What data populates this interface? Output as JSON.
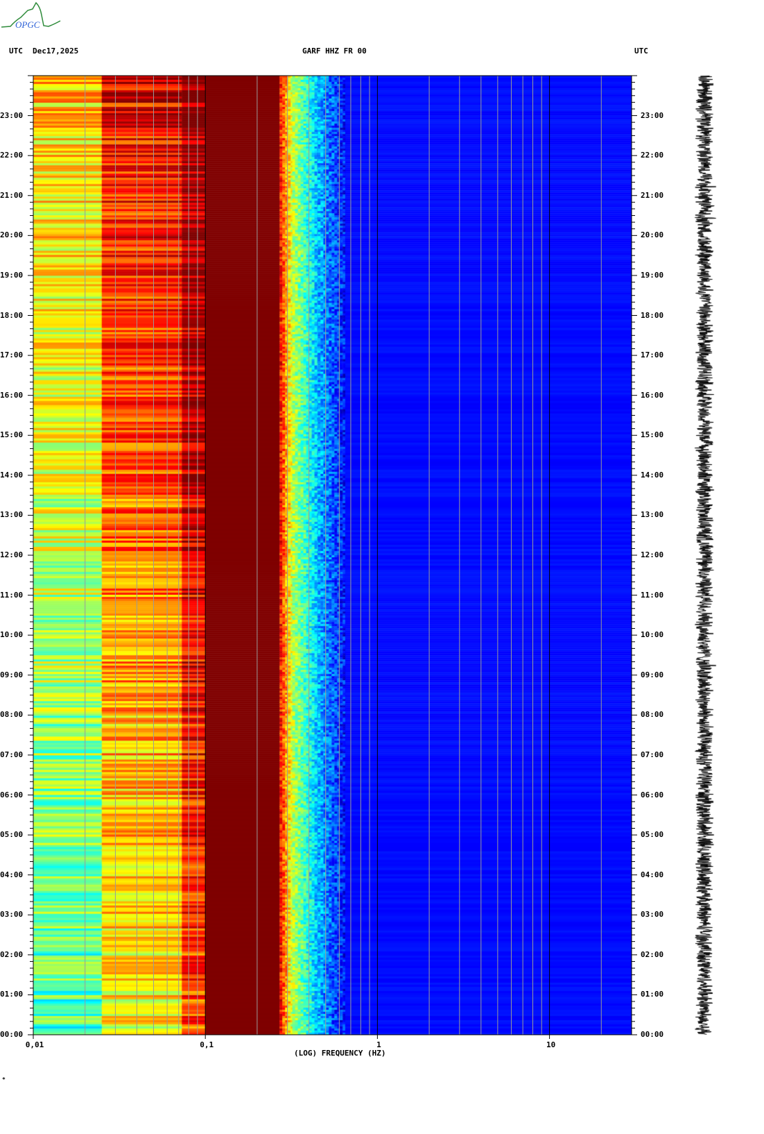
{
  "logo": {
    "text": "OPGC",
    "colors": {
      "curve": "#2e8b3a",
      "text": "#2a5fd6"
    }
  },
  "header": {
    "left_tz": "UTC",
    "date": "Dec17,2025",
    "station": "GARF HHZ FR 00",
    "right_tz": "UTC"
  },
  "footer": {
    "mark": "*"
  },
  "chart_data": {
    "type": "heatmap",
    "title": "GARF HHZ FR 00",
    "date": "Dec17,2025",
    "xlabel": "(LOG) FREQUENCY (HZ)",
    "xscale": "log",
    "xlim": [
      0.01,
      30
    ],
    "x_ticks": [
      {
        "value": 0.01,
        "label": "0,01"
      },
      {
        "value": 0.1,
        "label": "0,1"
      },
      {
        "value": 1,
        "label": "1"
      },
      {
        "value": 10,
        "label": "10"
      }
    ],
    "ylabel": "UTC",
    "ylim_hours": [
      0,
      24
    ],
    "y_ticks": [
      "00:00",
      "01:00",
      "02:00",
      "03:00",
      "04:00",
      "05:00",
      "06:00",
      "07:00",
      "08:00",
      "09:00",
      "10:00",
      "11:00",
      "12:00",
      "13:00",
      "14:00",
      "15:00",
      "16:00",
      "17:00",
      "18:00",
      "19:00",
      "20:00",
      "21:00",
      "22:00",
      "23:00"
    ],
    "minor_tick_minutes": 10,
    "colormap": "jet",
    "grid": true,
    "spectral_profile": [
      {
        "freq_range": [
          0.01,
          0.025
        ],
        "level_top": 0.68,
        "level_bottom": 0.45
      },
      {
        "freq_range": [
          0.025,
          0.05
        ],
        "level_top": 0.88,
        "level_bottom": 0.62
      },
      {
        "freq_range": [
          0.05,
          0.073
        ],
        "level_top": 0.9,
        "level_bottom": 0.63
      },
      {
        "freq_range": [
          0.073,
          0.1
        ],
        "level_top": 1.0,
        "level_bottom": 0.8
      },
      {
        "freq_range": [
          0.1,
          0.27
        ],
        "level_top": 1.0,
        "level_bottom": 1.0
      },
      {
        "freq_range": [
          0.27,
          0.32
        ],
        "level_top": 0.85,
        "level_bottom": 0.85
      },
      {
        "freq_range": [
          0.32,
          0.45
        ],
        "level_top": 0.55,
        "level_bottom": 0.55
      },
      {
        "freq_range": [
          0.45,
          0.65
        ],
        "level_top": 0.3,
        "level_bottom": 0.3
      },
      {
        "freq_range": [
          0.65,
          30
        ],
        "level_top": 0.13,
        "level_bottom": 0.13
      }
    ]
  }
}
